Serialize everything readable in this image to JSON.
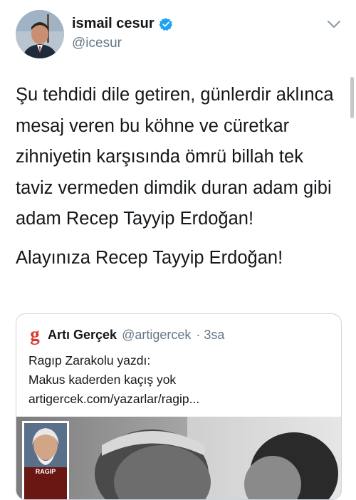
{
  "author": {
    "name": "ismail cesur",
    "handle": "@icesur",
    "verified_color": "#1da1f2"
  },
  "tweet": {
    "paragraphs": [
      "Şu tehdidi dile getiren, günlerdir aklınca mesaj veren bu köhne ve cüretkar zihniyetin karşısında ömrü billah tek taviz vermeden dimdik duran adam gibi adam Recep Tayyip Erdoğan!",
      "Alayınıza Recep Tayyip Erdoğan!"
    ]
  },
  "quoted": {
    "logo_letter": "g",
    "name": "Artı Gerçek",
    "handle": "@artigercek",
    "time": "3sa",
    "lines": [
      "Ragıp Zarakolu yazdı:",
      "Makus kaderden kaçış yok",
      "artigercek.com/yazarlar/ragip..."
    ],
    "image_label": "RAGIP"
  },
  "colors": {
    "text": "#14171a",
    "secondary": "#657786",
    "accent_logo": "#d9382b",
    "border": "#ccd6dd"
  }
}
